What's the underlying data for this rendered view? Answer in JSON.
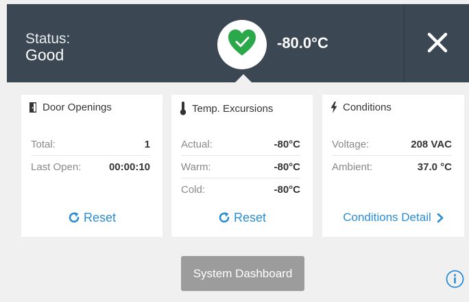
{
  "header": {
    "status_label": "Status:",
    "status_value": "Good",
    "temperature": "-80.0°C",
    "status_icon": "heart-check-icon",
    "close_icon": "close-icon",
    "status_color": "#2aa84a",
    "background": "#3b4753"
  },
  "cards": {
    "door": {
      "title": "Door Openings",
      "icon": "door-icon",
      "rows": [
        {
          "label": "Total:",
          "value": "1"
        },
        {
          "label": "Last Open:",
          "value": "00:00:10"
        }
      ],
      "reset_label": "Reset"
    },
    "temp": {
      "title": "Temp. Excursions",
      "icon": "thermometer-icon",
      "rows": [
        {
          "label": "Actual:",
          "value": "-80°C"
        },
        {
          "label": "Warm:",
          "value": "-80°C"
        },
        {
          "label": "Cold:",
          "value": "-80°C"
        }
      ],
      "reset_label": "Reset"
    },
    "conditions": {
      "title": "Conditions",
      "icon": "lightning-icon",
      "rows": [
        {
          "label": "Voltage:",
          "value": "208 VAC"
        },
        {
          "label": "Ambient:",
          "value": "37.0 °C"
        }
      ],
      "detail_label": "Conditions Detail"
    }
  },
  "footer": {
    "dashboard_label": "System Dashboard",
    "info_icon": "info-icon"
  },
  "accent_color": "#2a8dd4"
}
